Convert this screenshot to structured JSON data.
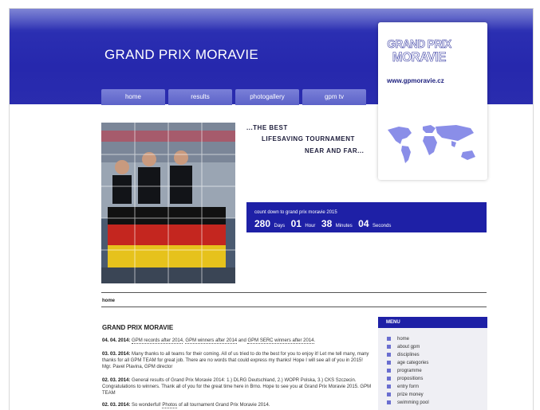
{
  "site": {
    "title": "GRAND PRIX MORAVIE"
  },
  "nav": [
    {
      "label": "home"
    },
    {
      "label": "results"
    },
    {
      "label": "photogallery"
    },
    {
      "label": "gpm tv"
    }
  ],
  "logo": {
    "line1": "GRAND PRIX",
    "line2": "MORAVIE",
    "url": "www.gpmoravie.cz"
  },
  "tagline": {
    "line1": "...THE BEST",
    "line2": "LIFESAVING TOURNAMENT",
    "line3": "NEAR AND FAR..."
  },
  "countdown": {
    "label": "count down to grand prix moravie 2015",
    "days": "280",
    "days_label": "Days",
    "hours": "01",
    "hours_label": "Hour",
    "minutes": "38",
    "minutes_label": "Minutes",
    "seconds": "04",
    "seconds_label": "Seconds"
  },
  "breadcrumb": "home",
  "content": {
    "title": "GRAND PRIX MORAVIE",
    "news": [
      {
        "date": "04. 04. 2014:",
        "links": [
          "GPM records after 2014",
          "GPM winners after 2014",
          "GPM SERC winners after 2014"
        ],
        "text_parts": [
          ", ",
          " and ",
          "."
        ]
      },
      {
        "date": "03. 03. 2014:",
        "text": "Many thanks to all teams for their coming. All of us tried to do the best for you to enjoy it! Let me tell many, many thanks for all GPM TEAM for great job. There are no words that could express my thanks! Hope I will see all of you in 2015! Mgr. Pavel Plavina, GPM director"
      },
      {
        "date": "02. 03. 2014:",
        "text": "General results of Grand Prix Moravie 2014: 1.) DLRG Deutschland, 2.) WOPR Polska, 3.) CKS Szczecin. Congratulations to winners. Thank all of you for the great time here in Brno. Hope to see you at Grand Prix Moravie 2015. GPM TEAM"
      },
      {
        "date": "02. 03. 2014:",
        "text_before": "So wonderful! ",
        "link": "Photos",
        "text_after": " of all tournament Grand Prix Moravie 2014."
      }
    ]
  },
  "menu": {
    "title": "MENU",
    "items": [
      "home",
      "about gpm",
      "disciplines",
      "age categories",
      "programme",
      "propositions",
      "entry form",
      "prize money",
      "swimming pool"
    ]
  }
}
